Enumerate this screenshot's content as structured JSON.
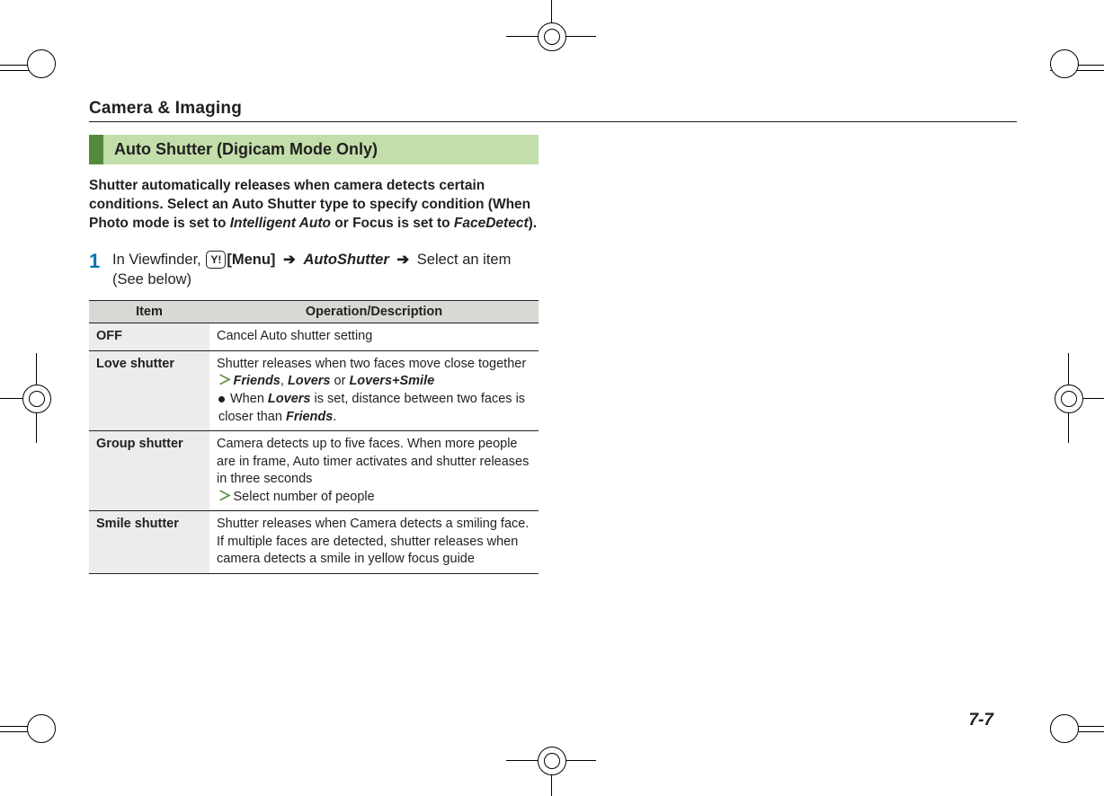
{
  "section": "Camera & Imaging",
  "heading": "Auto Shutter (Digicam Mode Only)",
  "intro": {
    "pre": "Shutter automatically releases when camera detects certain conditions. Select an Auto Shutter type to specify condition (When Photo mode is set to ",
    "ital1": "Intelligent Auto",
    "mid": " or Focus is set to ",
    "ital2": "FaceDetect",
    "post": ")."
  },
  "step": {
    "num": "1",
    "pre": "In Viewfinder, ",
    "key": "Y!",
    "menu": "[Menu]",
    "arrow": "➔",
    "term": "AutoShutter",
    "post": " Select an item (See below)"
  },
  "table": {
    "head_item": "Item",
    "head_desc": "Operation/Description",
    "rows": {
      "off": {
        "item": "OFF",
        "desc": "Cancel Auto shutter setting"
      },
      "love": {
        "item": "Love shutter",
        "line1": "Shutter releases when two faces move close together",
        "opt1": "Friends",
        "optsep1": ", ",
        "opt2": "Lovers",
        "optsep2": " or ",
        "opt3": "Lovers+Smile",
        "note_pre": "When ",
        "note_b1": "Lovers",
        "note_mid": " is set, distance between two faces is closer than ",
        "note_b2": "Friends",
        "note_post": "."
      },
      "group": {
        "item": "Group shutter",
        "line1": "Camera detects up to five faces. When more people are in frame, Auto timer activates and shutter releases in three seconds",
        "opt": "Select number of people"
      },
      "smile": {
        "item": "Smile shutter",
        "desc": "Shutter releases when Camera detects a smiling face. If multiple faces are detected, shutter releases when camera detects a smile in yellow focus guide"
      }
    }
  },
  "page": "7-7"
}
